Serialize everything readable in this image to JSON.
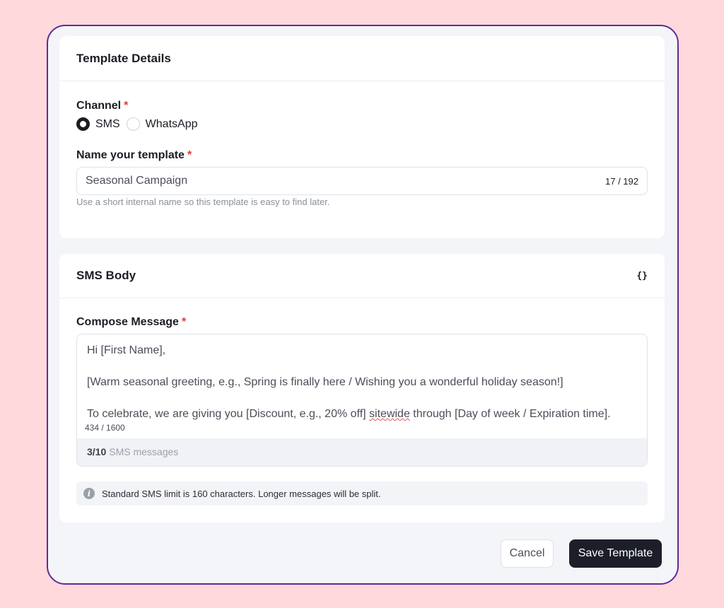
{
  "template_details": {
    "title": "Template Details",
    "channel": {
      "label": "Channel",
      "required_mark": "*",
      "options": [
        {
          "label": "SMS",
          "selected": true
        },
        {
          "label": "WhatsApp",
          "selected": false
        }
      ]
    },
    "name": {
      "label": "Name your template",
      "required_mark": "*",
      "value": "Seasonal Campaign",
      "count": "17 / 192",
      "hint": "Use a short internal name so this template is easy to find later."
    }
  },
  "sms_body": {
    "title": "SMS Body",
    "variables_icon": "{}",
    "compose": {
      "label": "Compose Message",
      "required_mark": "*",
      "lines": {
        "greeting": "Hi [First Name],",
        "seasonal": "[Warm seasonal greeting, e.g., Spring is finally here / Wishing you a wonderful holiday season!]",
        "offer_start": "To celebrate, we are giving you [Discount, e.g., 20% off] ",
        "offer_misspelled": "sitewide",
        "offer_end": " through [Day of week / Expiration time]."
      },
      "char_count": "434 / 1600",
      "sms_count": "3/10",
      "sms_label": "SMS messages"
    },
    "info": "Standard SMS limit is 160 characters. Longer messages will be split."
  },
  "actions": {
    "cancel": "Cancel",
    "save": "Save Template"
  }
}
